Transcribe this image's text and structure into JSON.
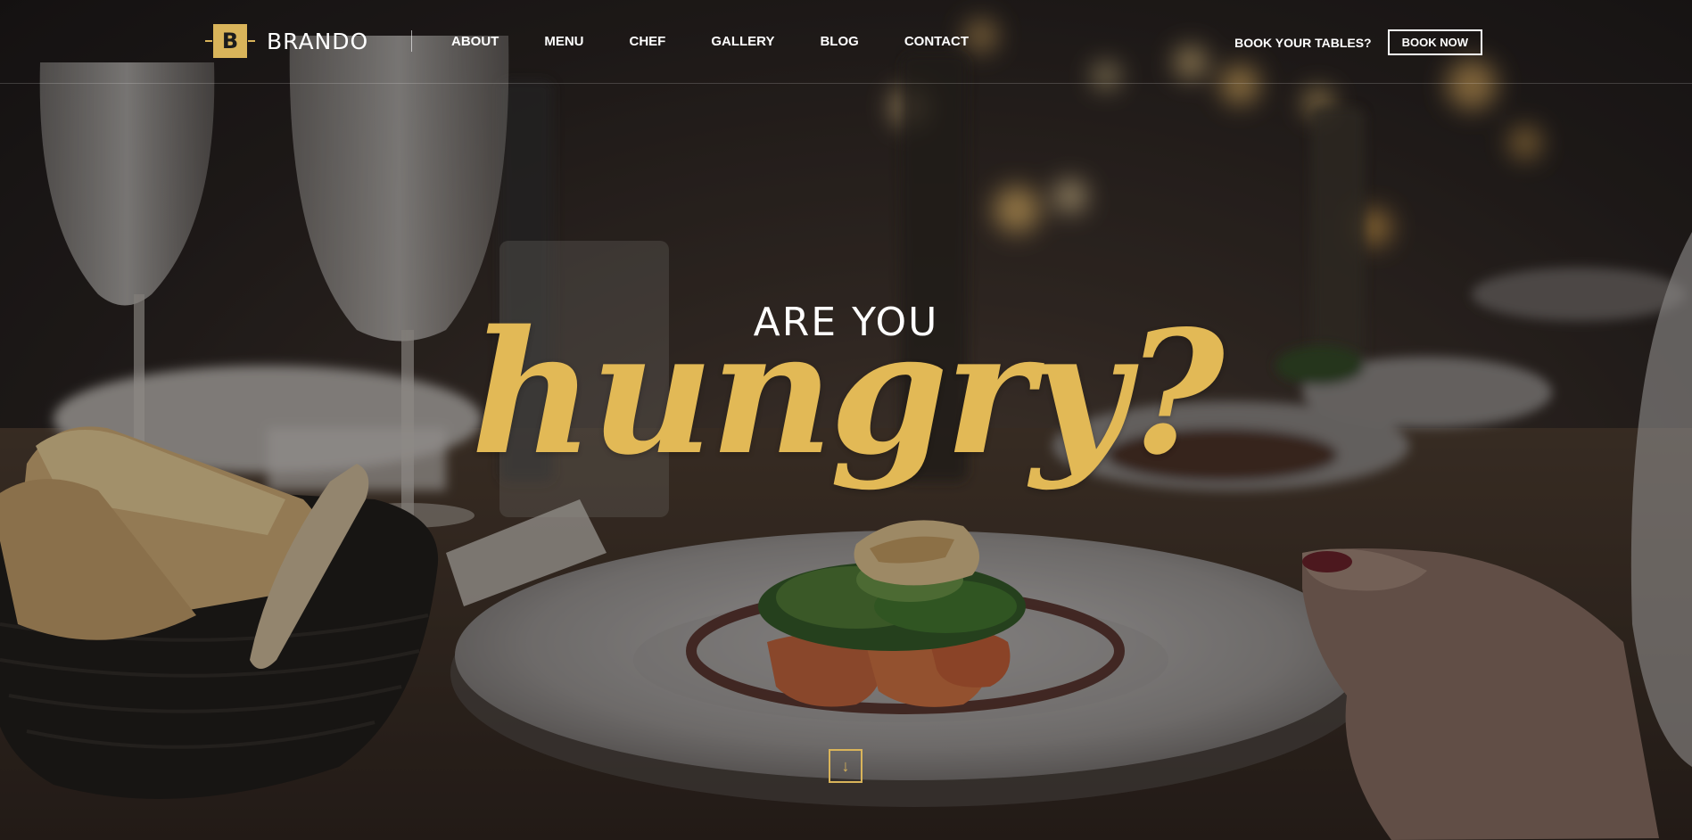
{
  "brand": {
    "logo_letter": "B",
    "name": "BRANDO",
    "accent_color": "#d9b45a"
  },
  "nav": {
    "items": [
      {
        "label": "ABOUT"
      },
      {
        "label": "MENU"
      },
      {
        "label": "CHEF"
      },
      {
        "label": "GALLERY"
      },
      {
        "label": "BLOG"
      },
      {
        "label": "CONTACT"
      }
    ]
  },
  "booking": {
    "question": "BOOK YOUR TABLES?",
    "button_label": "BOOK NOW"
  },
  "hero": {
    "line1": "ARE YOU",
    "line2": "hungry?",
    "line2_color": "#e2b956",
    "scroll_icon": "arrow-down-icon",
    "scroll_glyph": "↓"
  }
}
